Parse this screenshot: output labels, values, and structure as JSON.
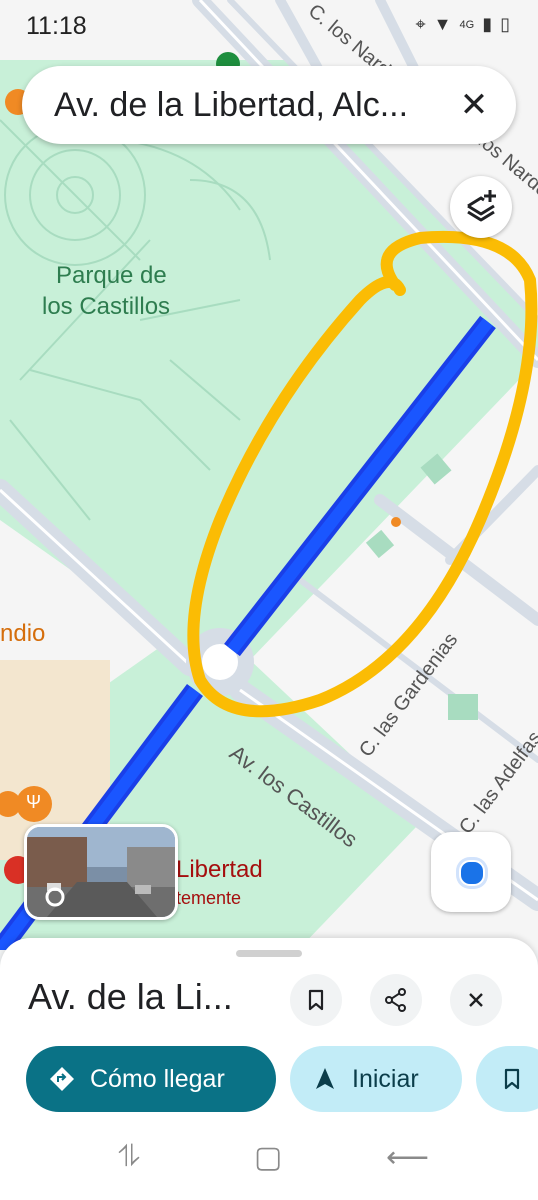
{
  "status_bar": {
    "time": "11:18",
    "network": "4G"
  },
  "search": {
    "query": "Av. de la Libertad, Alc...",
    "close_glyph": "✕"
  },
  "map": {
    "labels": {
      "park": "Parque de\nlos Castillos",
      "park_line1": "Parque de",
      "park_line2": "los Castillos",
      "street_castillos": "Av. los Castillos",
      "street_gardenias": "C. las Gardenias",
      "street_adelfas": "C. las Adelfas",
      "street_nardos_top": "C. los Nardos",
      "street_nardos_side": "los Nardos",
      "poi_left": "ndio",
      "poi_libertad": "Libertad",
      "poi_libertad_sub": "temente"
    },
    "colors": {
      "route": "#1a4ff0",
      "annotation": "#fbbc04",
      "park": "#c8f0d8",
      "road": "#d6dde6"
    }
  },
  "place": {
    "title": "Av. de la Li..."
  },
  "actions": {
    "directions": "Cómo llegar",
    "start": "Iniciar"
  },
  "icons": {
    "layers": "layers-icon",
    "my_location": "my-location-icon",
    "save": "bookmark-icon",
    "share": "share-icon",
    "close": "close-icon"
  }
}
